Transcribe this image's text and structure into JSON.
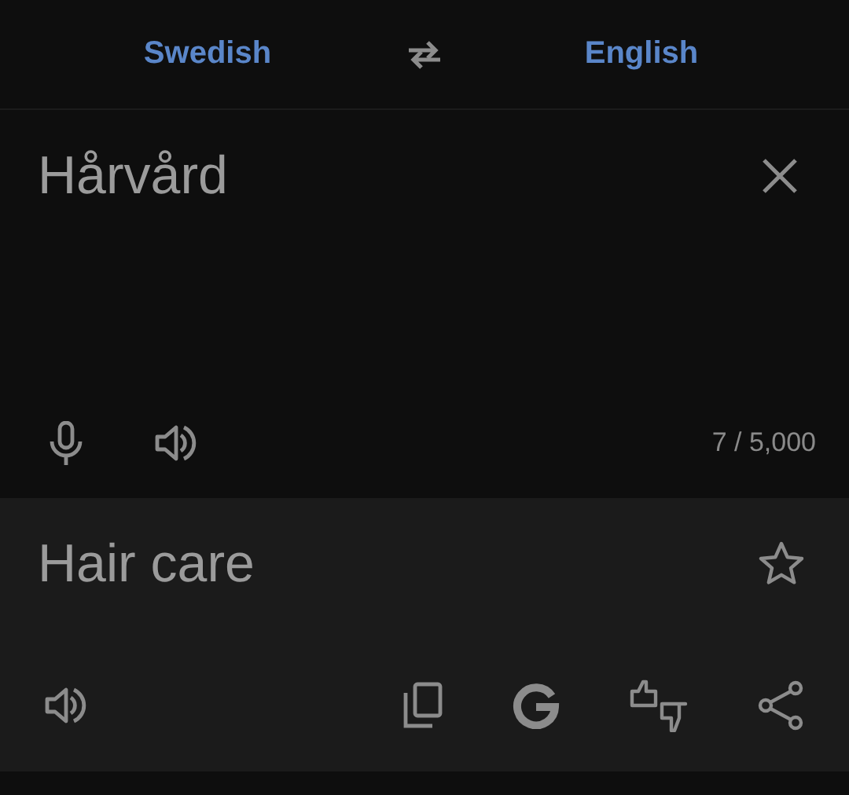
{
  "languages": {
    "source": "Swedish",
    "target": "English"
  },
  "input": {
    "value": "Hårvård",
    "char_count": "7 / 5,000"
  },
  "result": {
    "text": "Hair care",
    "starred": false
  }
}
